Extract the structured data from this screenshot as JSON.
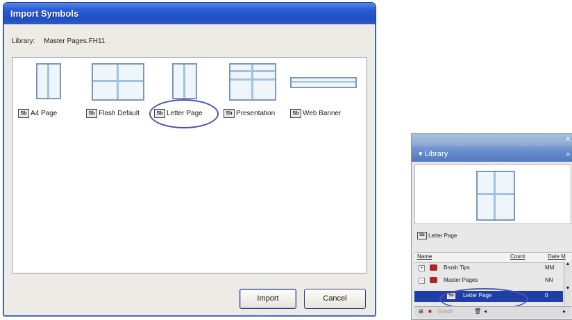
{
  "dialog": {
    "title": "Import Symbols",
    "library_label": "Library:",
    "library_value": "Master Pages.FH11",
    "items": [
      {
        "label": "A4 Page",
        "symbol": "Sb"
      },
      {
        "label": "Flash Default",
        "symbol": "Sb"
      },
      {
        "label": "Letter Page",
        "symbol": "Sb"
      },
      {
        "label": "Presentation",
        "symbol": "Sb"
      },
      {
        "label": "Web Banner",
        "symbol": "Sb"
      }
    ],
    "import_label": "Import",
    "cancel_label": "Cancel",
    "highlighted_item": "Letter Page"
  },
  "panel": {
    "title": "Library",
    "close_glyph": "x",
    "menu_glyph": "≡",
    "selected_name": "Letter Page",
    "selected_symbol": "Sb",
    "columns": [
      "Name",
      "Count",
      "Date M"
    ],
    "rows": [
      {
        "name": "Brush Tips",
        "count": "MM",
        "expander": "+"
      },
      {
        "name": "Master Pages",
        "count": "NN",
        "expander": "−"
      },
      {
        "name": "Letter Page",
        "count": "0",
        "selected": true,
        "symbol": "Sb"
      }
    ],
    "bottom_row_name": "Graph"
  },
  "colors": {
    "titlebar": "#1f4fc2",
    "highlight_ring": "#4d50b8",
    "selection": "#1f3fa6"
  }
}
